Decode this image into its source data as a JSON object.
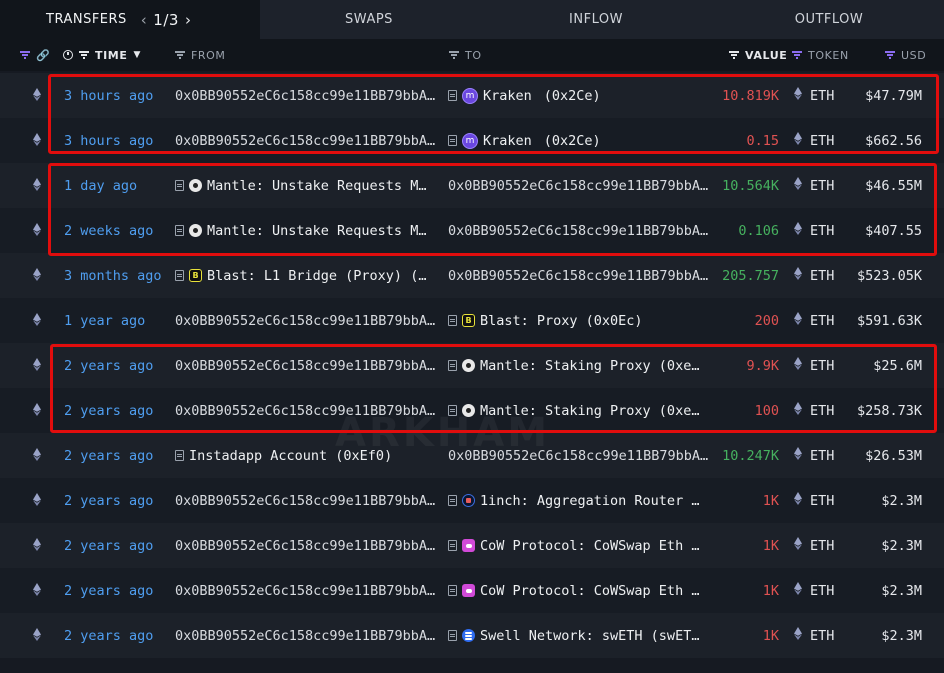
{
  "tabs": {
    "transfers": "TRANSFERS",
    "page_current": "1",
    "page_sep": "/",
    "page_total": "3",
    "swaps": "SWAPS",
    "inflow": "INFLOW",
    "outflow": "OUTFLOW"
  },
  "header": {
    "time": "TIME",
    "from": "FROM",
    "to": "TO",
    "value": "VALUE",
    "token": "TOKEN",
    "usd": "USD"
  },
  "watermark": "ARKHAM",
  "colors": {
    "accent_purple": "#8b6cf0",
    "time_blue": "#4f9ef0",
    "outflow_red": "#e05252",
    "inflow_green": "#46b15f",
    "highlight_red": "#e10d0d"
  },
  "rows": [
    {
      "time": "3 hours ago",
      "from": "0x0BB90552eC6c158cc99e11BB79bbA…",
      "from_icon": "",
      "to": "Kraken",
      "to_sub": "(0x2Ce)",
      "to_icon": "kraken-icon",
      "value": "10.819K",
      "dir": "out",
      "token": "ETH",
      "usd": "$47.79M"
    },
    {
      "time": "3 hours ago",
      "from": "0x0BB90552eC6c158cc99e11BB79bbA…",
      "from_icon": "",
      "to": "Kraken",
      "to_sub": "(0x2Ce)",
      "to_icon": "kraken-icon",
      "value": "0.15",
      "dir": "out",
      "token": "ETH",
      "usd": "$662.56"
    },
    {
      "time": "1 day ago",
      "from": "Mantle: Unstake Requests M…",
      "from_icon": "mantle-icon",
      "to": "0x0BB90552eC6c158cc99e11BB79bbA…",
      "to_sub": "",
      "to_icon": "",
      "value": "10.564K",
      "dir": "in",
      "token": "ETH",
      "usd": "$46.55M"
    },
    {
      "time": "2 weeks ago",
      "from": "Mantle: Unstake Requests M…",
      "from_icon": "mantle-icon",
      "to": "0x0BB90552eC6c158cc99e11BB79bbA…",
      "to_sub": "",
      "to_icon": "",
      "value": "0.106",
      "dir": "in",
      "token": "ETH",
      "usd": "$407.55"
    },
    {
      "time": "3 months ago",
      "from": "Blast: L1 Bridge (Proxy) (…",
      "from_icon": "blast-icon",
      "to": "0x0BB90552eC6c158cc99e11BB79bbA…",
      "to_sub": "",
      "to_icon": "",
      "value": "205.757",
      "dir": "in",
      "token": "ETH",
      "usd": "$523.05K"
    },
    {
      "time": "1 year ago",
      "from": "0x0BB90552eC6c158cc99e11BB79bbA…",
      "from_icon": "",
      "to": "Blast: Proxy (0x0Ec)",
      "to_sub": "",
      "to_icon": "blast-icon",
      "value": "200",
      "dir": "out",
      "token": "ETH",
      "usd": "$591.63K"
    },
    {
      "time": "2 years ago",
      "from": "0x0BB90552eC6c158cc99e11BB79bbA…",
      "from_icon": "",
      "to": "Mantle: Staking Proxy (0xe…",
      "to_sub": "",
      "to_icon": "mantle-icon",
      "value": "9.9K",
      "dir": "out",
      "token": "ETH",
      "usd": "$25.6M"
    },
    {
      "time": "2 years ago",
      "from": "0x0BB90552eC6c158cc99e11BB79bbA…",
      "from_icon": "",
      "to": "Mantle: Staking Proxy (0xe…",
      "to_sub": "",
      "to_icon": "mantle-icon",
      "value": "100",
      "dir": "out",
      "token": "ETH",
      "usd": "$258.73K"
    },
    {
      "time": "2 years ago",
      "from": "Instadapp Account (0xEf0)",
      "from_icon": "doc-only",
      "to": "0x0BB90552eC6c158cc99e11BB79bbA…",
      "to_sub": "",
      "to_icon": "",
      "value": "10.247K",
      "dir": "in",
      "token": "ETH",
      "usd": "$26.53M"
    },
    {
      "time": "2 years ago",
      "from": "0x0BB90552eC6c158cc99e11BB79bbA…",
      "from_icon": "",
      "to": "1inch: Aggregation Router …",
      "to_sub": "",
      "to_icon": "oneinch-icon",
      "value": "1K",
      "dir": "out",
      "token": "ETH",
      "usd": "$2.3M"
    },
    {
      "time": "2 years ago",
      "from": "0x0BB90552eC6c158cc99e11BB79bbA…",
      "from_icon": "",
      "to": "CoW Protocol: CoWSwap Eth …",
      "to_sub": "",
      "to_icon": "cow-icon",
      "value": "1K",
      "dir": "out",
      "token": "ETH",
      "usd": "$2.3M"
    },
    {
      "time": "2 years ago",
      "from": "0x0BB90552eC6c158cc99e11BB79bbA…",
      "from_icon": "",
      "to": "CoW Protocol: CoWSwap Eth …",
      "to_sub": "",
      "to_icon": "cow-icon",
      "value": "1K",
      "dir": "out",
      "token": "ETH",
      "usd": "$2.3M"
    },
    {
      "time": "2 years ago",
      "from": "0x0BB90552eC6c158cc99e11BB79bbA…",
      "from_icon": "",
      "to": "Swell Network: swETH (swET…",
      "to_sub": "",
      "to_icon": "swell-icon",
      "value": "1K",
      "dir": "out",
      "token": "ETH",
      "usd": "$2.3M"
    }
  ]
}
